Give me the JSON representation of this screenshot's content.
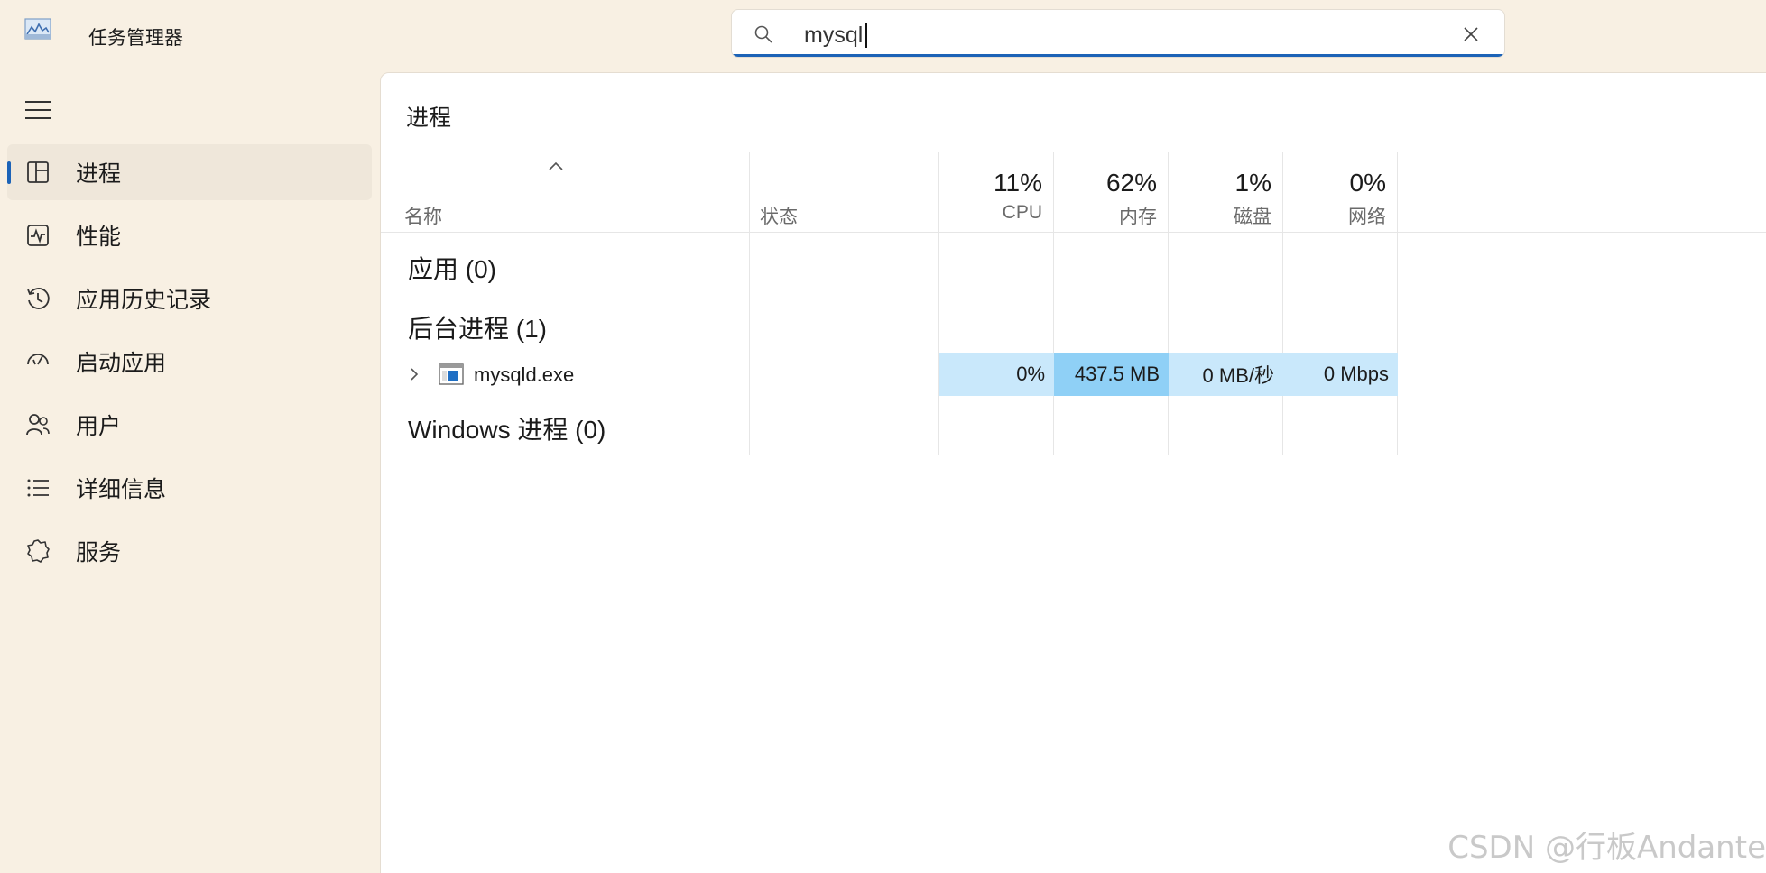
{
  "app": {
    "title": "任务管理器"
  },
  "search": {
    "value": "mysql",
    "placeholder": ""
  },
  "sidebar": {
    "items": [
      {
        "label": "进程",
        "icon": "processes-icon",
        "active": true
      },
      {
        "label": "性能",
        "icon": "performance-icon",
        "active": false
      },
      {
        "label": "应用历史记录",
        "icon": "app-history-icon",
        "active": false
      },
      {
        "label": "启动应用",
        "icon": "startup-apps-icon",
        "active": false
      },
      {
        "label": "用户",
        "icon": "users-icon",
        "active": false
      },
      {
        "label": "详细信息",
        "icon": "details-icon",
        "active": false
      },
      {
        "label": "服务",
        "icon": "services-icon",
        "active": false
      }
    ]
  },
  "main": {
    "title": "进程",
    "columns": {
      "name": "名称",
      "status": "状态",
      "cpu": {
        "percent": "11%",
        "label": "CPU"
      },
      "memory": {
        "percent": "62%",
        "label": "内存"
      },
      "disk": {
        "percent": "1%",
        "label": "磁盘"
      },
      "network": {
        "percent": "0%",
        "label": "网络"
      }
    },
    "groups": {
      "apps": "应用 (0)",
      "background": "后台进程 (1)",
      "windows": "Windows 进程 (0)"
    },
    "rows": [
      {
        "name": "mysqld.exe",
        "status": "",
        "cpu": "0%",
        "memory": "437.5 MB",
        "disk": "0 MB/秒",
        "network": "0 Mbps"
      }
    ]
  },
  "colors": {
    "accent": "#1c63b7",
    "background": "#f8f0e3",
    "heat_light": "#c9e8fb",
    "heat_strong": "#8fd0f6"
  },
  "watermark": "CSDN @行板Andante"
}
